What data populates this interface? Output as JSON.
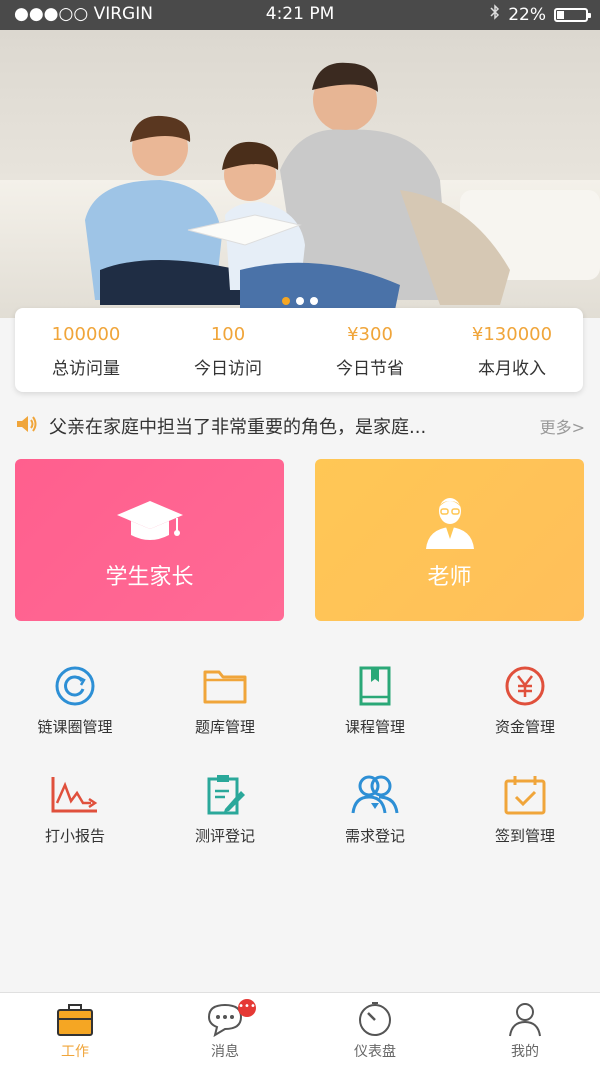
{
  "status_bar": {
    "carrier": "●●●○○ VIRGIN",
    "time": "4:21 PM",
    "battery": "22%"
  },
  "banner": {
    "slide_count": 3,
    "active_slide": 1
  },
  "stats": [
    {
      "value": "100000",
      "label": "总访问量"
    },
    {
      "value": "100",
      "label": "今日访问"
    },
    {
      "value": "¥300",
      "label": "今日节省"
    },
    {
      "value": "¥130000",
      "label": "本月收入"
    }
  ],
  "notice": {
    "text": "父亲在家庭中担当了非常重要的角色，是家庭...",
    "more": "更多>"
  },
  "roles": {
    "parent": "学生家长",
    "teacher": "老师"
  },
  "grid": [
    {
      "label": "链课圈管理",
      "icon": "refresh-circle-icon",
      "color": "#2d8fd5"
    },
    {
      "label": "题库管理",
      "icon": "folder-icon",
      "color": "#f0a53a"
    },
    {
      "label": "课程管理",
      "icon": "book-icon",
      "color": "#2aa877"
    },
    {
      "label": "资金管理",
      "icon": "yen-circle-icon",
      "color": "#e0503c"
    },
    {
      "label": "打小报告",
      "icon": "chart-pulse-icon",
      "color": "#e0503c"
    },
    {
      "label": "测评登记",
      "icon": "clipboard-edit-icon",
      "color": "#2aa89a"
    },
    {
      "label": "需求登记",
      "icon": "users-icon",
      "color": "#2d8fd5"
    },
    {
      "label": "签到管理",
      "icon": "calendar-check-icon",
      "color": "#f0a53a"
    }
  ],
  "tabbar": [
    {
      "label": "工作",
      "icon": "briefcase-icon",
      "active": true
    },
    {
      "label": "消息",
      "icon": "chat-icon",
      "badge": "•••"
    },
    {
      "label": "仪表盘",
      "icon": "dashboard-icon"
    },
    {
      "label": "我的",
      "icon": "user-icon"
    }
  ]
}
